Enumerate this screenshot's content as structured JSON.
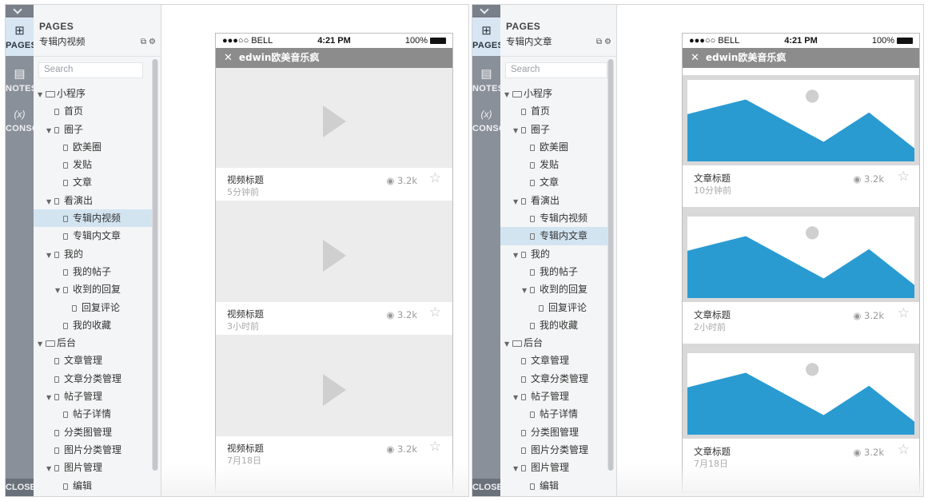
{
  "left": {
    "rail": {
      "pages": "PAGES",
      "notes": "NOTES",
      "console_glyph": "(x)",
      "console": "CONSOLE",
      "close": "CLOSE"
    },
    "panel": {
      "title": "PAGES",
      "page": "专辑内视频",
      "search_placeholder": "Search"
    },
    "tree": [
      {
        "label": "小程序",
        "level": 0,
        "type": "folder",
        "expanded": true,
        "selected": false
      },
      {
        "label": "首页",
        "level": 1,
        "type": "page",
        "expanded": false,
        "selected": false
      },
      {
        "label": "圈子",
        "level": 1,
        "type": "page",
        "expanded": true,
        "selected": false
      },
      {
        "label": "欧美圈",
        "level": 2,
        "type": "page",
        "expanded": false,
        "selected": false
      },
      {
        "label": "发贴",
        "level": 2,
        "type": "page",
        "expanded": false,
        "selected": false
      },
      {
        "label": "文章",
        "level": 2,
        "type": "page",
        "expanded": false,
        "selected": false
      },
      {
        "label": "看演出",
        "level": 1,
        "type": "page",
        "expanded": true,
        "selected": false
      },
      {
        "label": "专辑内视频",
        "level": 2,
        "type": "page",
        "expanded": false,
        "selected": true
      },
      {
        "label": "专辑内文章",
        "level": 2,
        "type": "page",
        "expanded": false,
        "selected": false
      },
      {
        "label": "我的",
        "level": 1,
        "type": "page",
        "expanded": true,
        "selected": false
      },
      {
        "label": "我的帖子",
        "level": 2,
        "type": "page",
        "expanded": false,
        "selected": false
      },
      {
        "label": "收到的回复",
        "level": 2,
        "type": "page",
        "expanded": true,
        "selected": false
      },
      {
        "label": "回复评论",
        "level": 3,
        "type": "page",
        "expanded": false,
        "selected": false
      },
      {
        "label": "我的收藏",
        "level": 2,
        "type": "page",
        "expanded": false,
        "selected": false
      },
      {
        "label": "后台",
        "level": 0,
        "type": "folder",
        "expanded": true,
        "selected": false
      },
      {
        "label": "文章管理",
        "level": 1,
        "type": "page",
        "expanded": false,
        "selected": false
      },
      {
        "label": "文章分类管理",
        "level": 1,
        "type": "page",
        "expanded": false,
        "selected": false
      },
      {
        "label": "帖子管理",
        "level": 1,
        "type": "page",
        "expanded": true,
        "selected": false
      },
      {
        "label": "帖子详情",
        "level": 2,
        "type": "page",
        "expanded": false,
        "selected": false
      },
      {
        "label": "分类图管理",
        "level": 1,
        "type": "page",
        "expanded": false,
        "selected": false
      },
      {
        "label": "图片分类管理",
        "level": 1,
        "type": "page",
        "expanded": false,
        "selected": false
      },
      {
        "label": "图片管理",
        "level": 1,
        "type": "page",
        "expanded": true,
        "selected": false
      },
      {
        "label": "编辑",
        "level": 2,
        "type": "page",
        "expanded": false,
        "selected": false
      }
    ],
    "phone": {
      "carrier": "●●●○○ BELL",
      "time": "4:21 PM",
      "battery": "100%",
      "nav_close": "✕",
      "nav_title": "edwin欧美音乐疯",
      "videos": [
        {
          "title": "视频标题",
          "time": "5分钟前",
          "views": "3.2k"
        },
        {
          "title": "视频标题",
          "time": "3小时前",
          "views": "3.2k"
        },
        {
          "title": "视频标题",
          "time": "7月18日",
          "views": "3.2k"
        }
      ]
    }
  },
  "right": {
    "rail": {
      "pages": "PAGES",
      "notes": "NOTES",
      "console_glyph": "(x)",
      "console": "CONSOLE",
      "close": "CLOSE"
    },
    "panel": {
      "title": "PAGES",
      "page": "专辑内文章",
      "search_placeholder": "Search"
    },
    "selected_label": "专辑内文章",
    "phone": {
      "carrier": "●●●○○ BELL",
      "time": "4:21 PM",
      "battery": "100%",
      "nav_close": "✕",
      "nav_title": "edwin欧美音乐疯",
      "articles": [
        {
          "title": "文章标题",
          "time": "10分钟前",
          "views": "3.2k"
        },
        {
          "title": "文章标题",
          "time": "2小时前",
          "views": "3.2k"
        },
        {
          "title": "文章标题",
          "time": "7月18日",
          "views": "3.2k"
        }
      ]
    }
  },
  "colors": {
    "accent_blue": "#2a9bd1",
    "selection": "#d3e4f1",
    "rail": "#8a9099",
    "navbar": "#8c8c8c"
  },
  "icons": {
    "sitemap": "sitemap-icon",
    "notes": "notes-icon",
    "star": "star-icon",
    "eye": "eye-icon",
    "play": "play-icon"
  }
}
